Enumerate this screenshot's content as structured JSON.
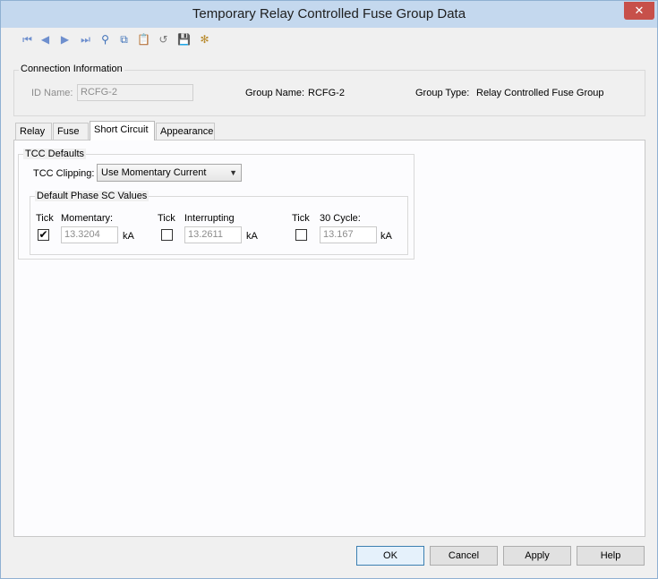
{
  "window": {
    "title": "Temporary Relay Controlled Fuse Group Data",
    "close_glyph": "✕"
  },
  "toolbar": {
    "buttons": [
      {
        "icon": "first-record-icon",
        "glyph": "⏮"
      },
      {
        "icon": "previous-record-icon",
        "glyph": "◀"
      },
      {
        "icon": "next-record-icon",
        "glyph": "▶"
      },
      {
        "icon": "last-record-icon",
        "glyph": "⏭"
      },
      {
        "icon": "binoculars-icon",
        "glyph": "⚲"
      },
      {
        "icon": "copy-icon",
        "glyph": "⧉"
      },
      {
        "icon": "paste-icon",
        "glyph": "📋"
      },
      {
        "icon": "undo-icon",
        "glyph": "↺"
      },
      {
        "icon": "save-icon",
        "glyph": "💾"
      },
      {
        "icon": "settings-icon",
        "glyph": "✻"
      }
    ]
  },
  "connection": {
    "legend": "Connection Information",
    "id_label": "ID Name:",
    "id_value": "RCFG-2",
    "group_name_label": "Group Name:",
    "group_name_value": "RCFG-2",
    "group_type_label": "Group Type:",
    "group_type_value": "Relay Controlled Fuse Group"
  },
  "tabs": [
    {
      "label": "Relay",
      "active": false
    },
    {
      "label": "Fuse",
      "active": false
    },
    {
      "label": "Short Circuit",
      "active": true
    },
    {
      "label": "Appearance",
      "active": false
    }
  ],
  "tcc": {
    "legend": "TCC Defaults",
    "clipping_label": "TCC Clipping:",
    "clipping_value": "Use Momentary Current",
    "phase": {
      "legend": "Default Phase SC Values",
      "columns": [
        {
          "tick_label": "Tick",
          "label": "Momentary:",
          "checked": true,
          "check_glyph": "✔",
          "value": "13.3204",
          "unit": "kA"
        },
        {
          "tick_label": "Tick",
          "label": "Interrupting",
          "checked": false,
          "check_glyph": "",
          "value": "13.2611",
          "unit": "kA"
        },
        {
          "tick_label": "Tick",
          "label": "30 Cycle:",
          "checked": false,
          "check_glyph": "",
          "value": "13.167",
          "unit": "kA"
        }
      ]
    }
  },
  "buttons": {
    "ok": "OK",
    "cancel": "Cancel",
    "apply": "Apply",
    "help": "Help"
  },
  "colors": {
    "title_bar": "#c4d8ee",
    "close": "#c7504a",
    "toolbar_icon": "#6e8fce",
    "default_button_border": "#3c7fb1"
  }
}
